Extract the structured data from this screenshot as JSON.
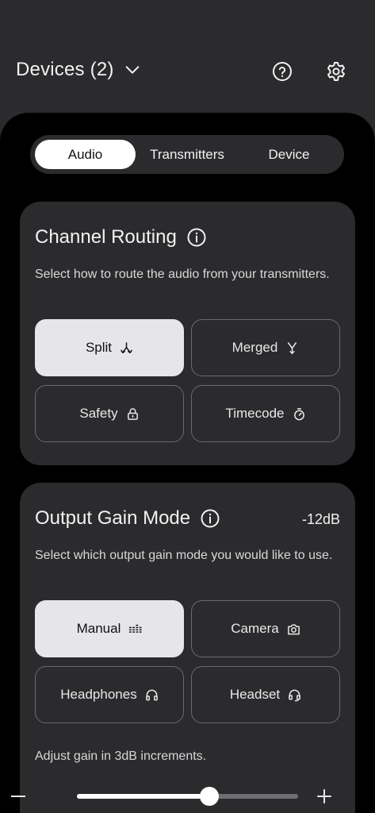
{
  "header": {
    "devices_label": "Devices (2)",
    "help_icon": "help-circle-icon",
    "settings_icon": "gear-icon"
  },
  "tabs": [
    {
      "label": "Audio",
      "active": true
    },
    {
      "label": "Transmitters",
      "active": false
    },
    {
      "label": "Device",
      "active": false
    }
  ],
  "channel_routing": {
    "title": "Channel Routing",
    "description": "Select how to route the audio from your transmitters.",
    "options": [
      {
        "label": "Split",
        "icon": "split-icon",
        "selected": true
      },
      {
        "label": "Merged",
        "icon": "merge-icon",
        "selected": false
      },
      {
        "label": "Safety",
        "icon": "lock-icon",
        "selected": false
      },
      {
        "label": "Timecode",
        "icon": "stopwatch-icon",
        "selected": false
      }
    ]
  },
  "output_gain": {
    "title": "Output Gain Mode",
    "value": "-12dB",
    "description": "Select which output gain mode you would like to use.",
    "options": [
      {
        "label": "Manual",
        "icon": "level-bars-icon",
        "selected": true
      },
      {
        "label": "Camera",
        "icon": "camera-icon",
        "selected": false
      },
      {
        "label": "Headphones",
        "icon": "headphones-icon",
        "selected": false
      },
      {
        "label": "Headset",
        "icon": "headset-icon",
        "selected": false
      }
    ],
    "adjust_text": "Adjust gain in 3dB increments.",
    "slider_fraction": 0.6
  },
  "colors": {
    "background": "#2b2b2e",
    "panel": "#000000",
    "selected": "#e6e6ea",
    "text": "#f2f2f2"
  }
}
